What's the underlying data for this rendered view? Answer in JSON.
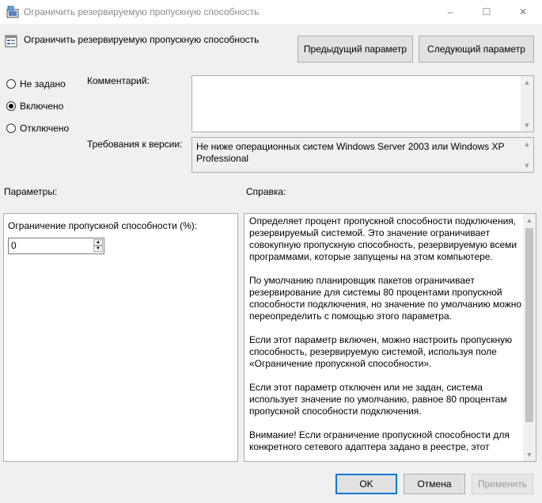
{
  "window": {
    "title": "Ограничить резервируемую пропускную способность",
    "min_glyph": "–",
    "max_glyph": "☐",
    "close_glyph": "✕"
  },
  "header": {
    "setting_title": "Ограничить резервируемую пропускную способность",
    "prev_button": "Предыдущий параметр",
    "next_button": "Следующий параметр"
  },
  "state": {
    "options": [
      "Не задано",
      "Включено",
      "Отключено"
    ],
    "selected": "Включено"
  },
  "comment": {
    "label": "Комментарий:",
    "value": ""
  },
  "version": {
    "label": "Требования к версии:",
    "value": "Не ниже операционных систем Windows Server 2003 или Windows XP Professional"
  },
  "params": {
    "label": "Параметры:",
    "bandwidth_label": "Ограничение пропускной способности (%):",
    "bandwidth_value": "0"
  },
  "help": {
    "label": "Справка:",
    "paragraphs": [
      "Определяет процент пропускной способности подключения, резервируемый системой. Это значение ограничивает совокупную пропускную способность, резервируемую всеми программами, которые запущены на этом компьютере.",
      "По умолчанию планировщик пакетов ограничивает резервирование для системы 80 процентами пропускной способности подключения, но значение по умолчанию можно переопределить с помощью этого параметра.",
      "Если этот параметр включен, можно настроить пропускную способность, резервируемую системой, используя поле «Ограничение пропускной способности».",
      "Если этот параметр отключен или не задан, система использует значение по умолчанию, равное 80 процентам пропускной способности подключения.",
      "Внимание! Если ограничение пропускной способности для конкретного сетевого адаптера задано в реестре, этот"
    ]
  },
  "footer": {
    "ok": "OK",
    "cancel": "Отмена",
    "apply": "Применить"
  },
  "colors": {
    "accent": "#0078d7",
    "dialog_bg": "#f0f0f0",
    "disabled_text": "#9a9a9a"
  }
}
